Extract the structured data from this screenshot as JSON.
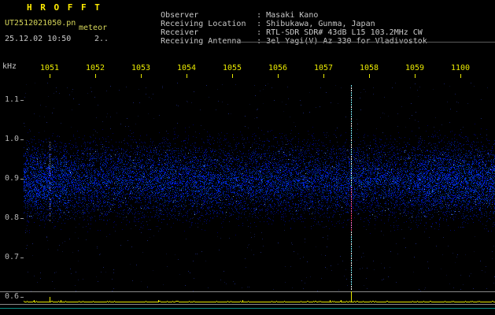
{
  "header": {
    "app_title": "H R O F F T",
    "filename": "UT2512021050.pn",
    "mode": "meteor",
    "datetime": "25.12.02 10:50",
    "counter": "2..",
    "info": [
      {
        "label": "Observer",
        "value": ": Masaki Kano"
      },
      {
        "label": "Receiving Location",
        "value": ": Shibukawa, Gunma, Japan"
      },
      {
        "label": "Receiver",
        "value": ": RTL-SDR SDR# 43dB L15 103.2MHz CW"
      },
      {
        "label": "Receiving Antenna",
        "value": ": 3el Yagi(V) Az 330 for Vladivostok"
      }
    ]
  },
  "chart_data": {
    "type": "heatmap",
    "subtype": "meteor-radio-spectrogram",
    "y_unit": "kHz",
    "x_ticks": [
      "1051",
      "1052",
      "1053",
      "1054",
      "1055",
      "1056",
      "1057",
      "1058",
      "1059",
      "1100"
    ],
    "y_ticks": [
      "1.1",
      "1.0",
      "0.9",
      "0.8",
      "0.7",
      "0.6"
    ],
    "x_range_ut": [
      "10:50",
      "11:00"
    ],
    "y_range_khz": [
      0.55,
      1.15
    ],
    "grid": false,
    "legend": "none",
    "features": [
      {
        "kind": "noise-band",
        "freq_khz": [
          0.78,
          1.01
        ],
        "time_span": "full",
        "color": "#0030c0"
      },
      {
        "kind": "carrier-line",
        "time_ut": "10:57.6",
        "freq_khz": [
          0.57,
          1.15
        ],
        "red_freq_khz": [
          0.77,
          0.885
        ],
        "color": "#7df2ff"
      },
      {
        "kind": "faint-trail",
        "time_ut": "10:51.0",
        "freq_khz": [
          0.79,
          1.0
        ],
        "color": "#c8d2ff"
      },
      {
        "kind": "amplitude-trace",
        "baseline": "flat",
        "spikes_ut": [
          "10:51.0",
          "10:57.6"
        ],
        "color": "#e6e600"
      }
    ],
    "colors": {
      "background": "#000000",
      "time_axis": "#e8e800",
      "freq_axis": "#b4b4b4",
      "noise": "#0030c0",
      "carrier": "#7df2ff",
      "trace": "#e6e600",
      "baseline_indicator": "#0b8f86"
    }
  }
}
